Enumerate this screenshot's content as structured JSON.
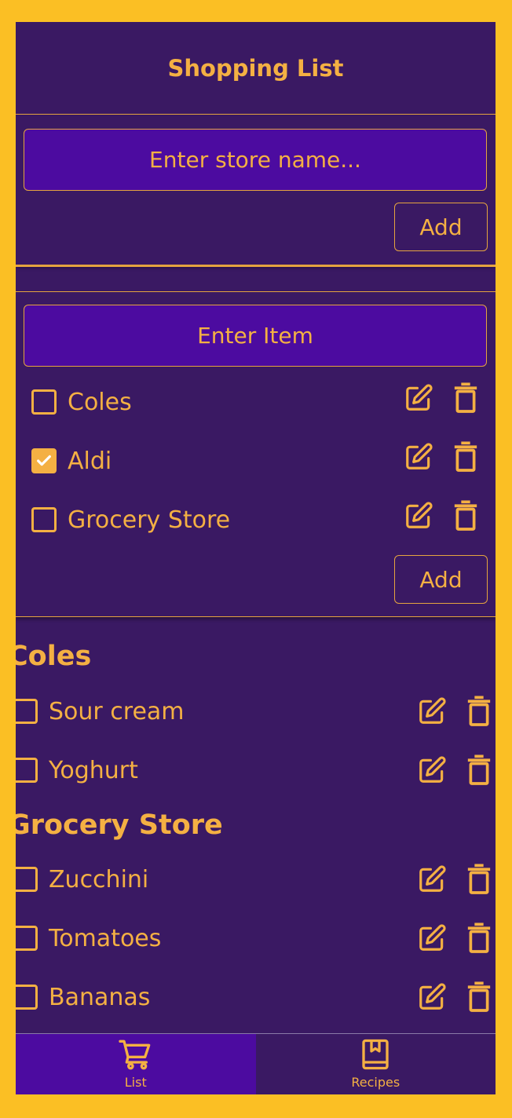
{
  "header": {
    "title": "Shopping List"
  },
  "store_form": {
    "placeholder": "Enter store name...",
    "add_label": "Add"
  },
  "item_form": {
    "placeholder": "Enter Item",
    "add_label": "Add",
    "stores": [
      {
        "label": "Coles",
        "checked": false
      },
      {
        "label": "Aldi",
        "checked": true
      },
      {
        "label": "Grocery Store",
        "checked": false
      }
    ]
  },
  "groups": [
    {
      "title": "Coles",
      "items": [
        {
          "label": "Sour cream",
          "checked": false
        },
        {
          "label": "Yoghurt",
          "checked": false
        }
      ]
    },
    {
      "title": "Grocery Store",
      "items": [
        {
          "label": "Zucchini",
          "checked": false
        },
        {
          "label": "Tomatoes",
          "checked": false
        },
        {
          "label": "Bananas",
          "checked": false
        }
      ]
    }
  ],
  "nav": {
    "tabs": [
      {
        "label": "List",
        "icon": "cart-icon",
        "active": true
      },
      {
        "label": "Recipes",
        "icon": "book-icon",
        "active": false
      }
    ]
  },
  "colors": {
    "background": "#3a1963",
    "accent": "#f4b043",
    "input_bg": "#4c0ba0",
    "frame": "#fbbf24"
  }
}
